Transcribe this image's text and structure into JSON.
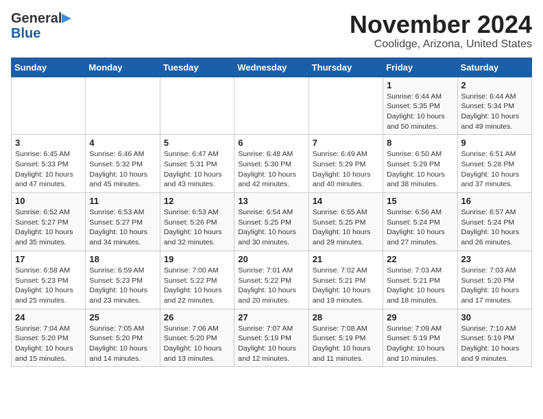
{
  "header": {
    "logo_general": "General",
    "logo_blue": "Blue",
    "title": "November 2024",
    "subtitle": "Coolidge, Arizona, United States"
  },
  "weekdays": [
    "Sunday",
    "Monday",
    "Tuesday",
    "Wednesday",
    "Thursday",
    "Friday",
    "Saturday"
  ],
  "weeks": [
    [
      {
        "day": "",
        "info": ""
      },
      {
        "day": "",
        "info": ""
      },
      {
        "day": "",
        "info": ""
      },
      {
        "day": "",
        "info": ""
      },
      {
        "day": "",
        "info": ""
      },
      {
        "day": "1",
        "info": "Sunrise: 6:44 AM\nSunset: 5:35 PM\nDaylight: 10 hours\nand 50 minutes."
      },
      {
        "day": "2",
        "info": "Sunrise: 6:44 AM\nSunset: 5:34 PM\nDaylight: 10 hours\nand 49 minutes."
      }
    ],
    [
      {
        "day": "3",
        "info": "Sunrise: 6:45 AM\nSunset: 5:33 PM\nDaylight: 10 hours\nand 47 minutes."
      },
      {
        "day": "4",
        "info": "Sunrise: 6:46 AM\nSunset: 5:32 PM\nDaylight: 10 hours\nand 45 minutes."
      },
      {
        "day": "5",
        "info": "Sunrise: 6:47 AM\nSunset: 5:31 PM\nDaylight: 10 hours\nand 43 minutes."
      },
      {
        "day": "6",
        "info": "Sunrise: 6:48 AM\nSunset: 5:30 PM\nDaylight: 10 hours\nand 42 minutes."
      },
      {
        "day": "7",
        "info": "Sunrise: 6:49 AM\nSunset: 5:29 PM\nDaylight: 10 hours\nand 40 minutes."
      },
      {
        "day": "8",
        "info": "Sunrise: 6:50 AM\nSunset: 5:29 PM\nDaylight: 10 hours\nand 38 minutes."
      },
      {
        "day": "9",
        "info": "Sunrise: 6:51 AM\nSunset: 5:28 PM\nDaylight: 10 hours\nand 37 minutes."
      }
    ],
    [
      {
        "day": "10",
        "info": "Sunrise: 6:52 AM\nSunset: 5:27 PM\nDaylight: 10 hours\nand 35 minutes."
      },
      {
        "day": "11",
        "info": "Sunrise: 6:53 AM\nSunset: 5:27 PM\nDaylight: 10 hours\nand 34 minutes."
      },
      {
        "day": "12",
        "info": "Sunrise: 6:53 AM\nSunset: 5:26 PM\nDaylight: 10 hours\nand 32 minutes."
      },
      {
        "day": "13",
        "info": "Sunrise: 6:54 AM\nSunset: 5:25 PM\nDaylight: 10 hours\nand 30 minutes."
      },
      {
        "day": "14",
        "info": "Sunrise: 6:55 AM\nSunset: 5:25 PM\nDaylight: 10 hours\nand 29 minutes."
      },
      {
        "day": "15",
        "info": "Sunrise: 6:56 AM\nSunset: 5:24 PM\nDaylight: 10 hours\nand 27 minutes."
      },
      {
        "day": "16",
        "info": "Sunrise: 6:57 AM\nSunset: 5:24 PM\nDaylight: 10 hours\nand 26 minutes."
      }
    ],
    [
      {
        "day": "17",
        "info": "Sunrise: 6:58 AM\nSunset: 5:23 PM\nDaylight: 10 hours\nand 25 minutes."
      },
      {
        "day": "18",
        "info": "Sunrise: 6:59 AM\nSunset: 5:23 PM\nDaylight: 10 hours\nand 23 minutes."
      },
      {
        "day": "19",
        "info": "Sunrise: 7:00 AM\nSunset: 5:22 PM\nDaylight: 10 hours\nand 22 minutes."
      },
      {
        "day": "20",
        "info": "Sunrise: 7:01 AM\nSunset: 5:22 PM\nDaylight: 10 hours\nand 20 minutes."
      },
      {
        "day": "21",
        "info": "Sunrise: 7:02 AM\nSunset: 5:21 PM\nDaylight: 10 hours\nand 19 minutes."
      },
      {
        "day": "22",
        "info": "Sunrise: 7:03 AM\nSunset: 5:21 PM\nDaylight: 10 hours\nand 18 minutes."
      },
      {
        "day": "23",
        "info": "Sunrise: 7:03 AM\nSunset: 5:20 PM\nDaylight: 10 hours\nand 17 minutes."
      }
    ],
    [
      {
        "day": "24",
        "info": "Sunrise: 7:04 AM\nSunset: 5:20 PM\nDaylight: 10 hours\nand 15 minutes."
      },
      {
        "day": "25",
        "info": "Sunrise: 7:05 AM\nSunset: 5:20 PM\nDaylight: 10 hours\nand 14 minutes."
      },
      {
        "day": "26",
        "info": "Sunrise: 7:06 AM\nSunset: 5:20 PM\nDaylight: 10 hours\nand 13 minutes."
      },
      {
        "day": "27",
        "info": "Sunrise: 7:07 AM\nSunset: 5:19 PM\nDaylight: 10 hours\nand 12 minutes."
      },
      {
        "day": "28",
        "info": "Sunrise: 7:08 AM\nSunset: 5:19 PM\nDaylight: 10 hours\nand 11 minutes."
      },
      {
        "day": "29",
        "info": "Sunrise: 7:09 AM\nSunset: 5:19 PM\nDaylight: 10 hours\nand 10 minutes."
      },
      {
        "day": "30",
        "info": "Sunrise: 7:10 AM\nSunset: 5:19 PM\nDaylight: 10 hours\nand 9 minutes."
      }
    ]
  ]
}
